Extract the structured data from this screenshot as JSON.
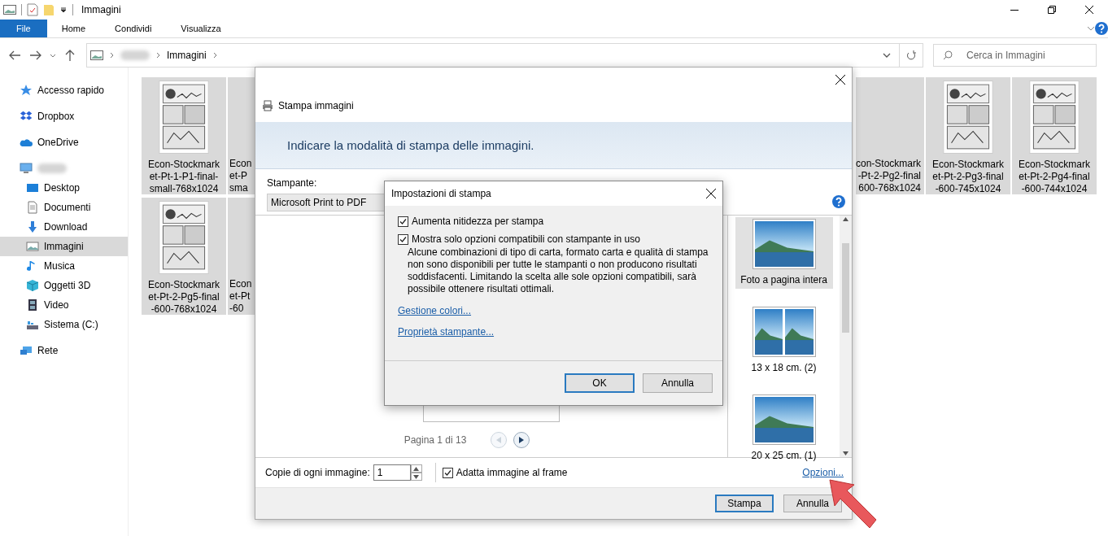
{
  "window": {
    "title": "Immagini"
  },
  "ribbon_tabs": [
    {
      "label": "File",
      "selected": true
    },
    {
      "label": "Home",
      "selected": false
    },
    {
      "label": "Condividi",
      "selected": false
    },
    {
      "label": "Visualizza",
      "selected": false
    }
  ],
  "address": {
    "segments": [
      "Immagini"
    ]
  },
  "search": {
    "placeholder": "Cerca in Immagini"
  },
  "sidebar": {
    "items": [
      {
        "kind": "star",
        "label": "Accesso rapido",
        "selected": false
      },
      {
        "kind": "dropbox",
        "label": "Dropbox",
        "selected": false
      },
      {
        "kind": "cloud",
        "label": "OneDrive",
        "selected": false
      },
      {
        "kind": "pc",
        "selected": false,
        "children": [
          {
            "kind": "desktop",
            "label": "Desktop",
            "selected": false
          },
          {
            "kind": "document",
            "label": "Documenti",
            "selected": false
          },
          {
            "kind": "download",
            "label": "Download",
            "selected": false
          },
          {
            "kind": "pictures",
            "label": "Immagini",
            "selected": true
          },
          {
            "kind": "music",
            "label": "Musica",
            "selected": false
          },
          {
            "kind": "cube",
            "label": "Oggetti 3D",
            "selected": false
          },
          {
            "kind": "video",
            "label": "Video",
            "selected": false
          },
          {
            "kind": "drive",
            "label": "Sistema (C:)",
            "selected": false
          }
        ]
      },
      {
        "kind": "network",
        "label": "Rete",
        "selected": false
      }
    ]
  },
  "files": [
    [
      {
        "lines": [
          "Econ-Stockmark",
          "et-Pt-1-P1-final-",
          "small-768x1024"
        ],
        "selected": true
      },
      {
        "lines": [
          "Econ",
          "et-P",
          "sma"
        ],
        "selected": true,
        "partial": true
      },
      {
        "lines": [
          "con-Stockmark",
          "-Pt-2-Pg2-final",
          "600-768x1024"
        ],
        "selected": true,
        "partial": true
      },
      {
        "lines": [
          "Econ-Stockmark",
          "et-Pt-2-Pg3-final",
          "-600-745x1024"
        ],
        "selected": true
      },
      {
        "lines": [
          "Econ-Stockmark",
          "et-Pt-2-Pg4-final",
          "-600-744x1024"
        ],
        "selected": true
      }
    ],
    [
      {
        "lines": [
          "Econ-Stockmark",
          "et-Pt-2-Pg5-final",
          "-600-768x1024"
        ],
        "selected": true
      },
      {
        "lines": [
          "Econ",
          "et-Pt",
          "-60"
        ],
        "selected": true,
        "partial": true
      }
    ]
  ],
  "print_dialog": {
    "title": "Stampa immagini",
    "heading": "Indicare la modalità di stampa delle immagini.",
    "printer_label": "Stampante:",
    "printer": "Microsoft Print to PDF",
    "pager": "Pagina 1 di 13",
    "layouts": [
      {
        "label": "Foto a pagina intera",
        "kind": "single",
        "selected": true
      },
      {
        "label": "13 x 18 cm. (2)",
        "kind": "double",
        "selected": false
      },
      {
        "label": "20 x 25 cm. (1)",
        "kind": "single",
        "selected": false
      }
    ],
    "copies_label": "Copie di ogni immagine:",
    "copies": "1",
    "fit": {
      "label": "Adatta immagine al frame",
      "checked": true
    },
    "options_link": "Opzioni...",
    "buttons": [
      {
        "label": "Stampa",
        "default": true
      },
      {
        "label": "Annulla",
        "default": false
      }
    ]
  },
  "settings_dialog": {
    "title": "Impostazioni di stampa",
    "options": [
      {
        "label": "Aumenta nitidezza per stampa",
        "checked": true
      },
      {
        "label": "Mostra solo opzioni compatibili con stampante in uso",
        "checked": true,
        "description": "Alcune combinazioni di tipo di carta, formato carta e qualità di stampa non sono disponibili per tutte le stampanti o non producono risultati soddisfacenti. Limitando la scelta alle sole opzioni compatibili, sarà possibile ottenere risultati ottimali."
      }
    ],
    "links": [
      "Gestione colori...",
      "Proprietà stampante..."
    ],
    "buttons": [
      {
        "label": "OK",
        "default": true
      },
      {
        "label": "Annulla",
        "default": false
      }
    ]
  }
}
